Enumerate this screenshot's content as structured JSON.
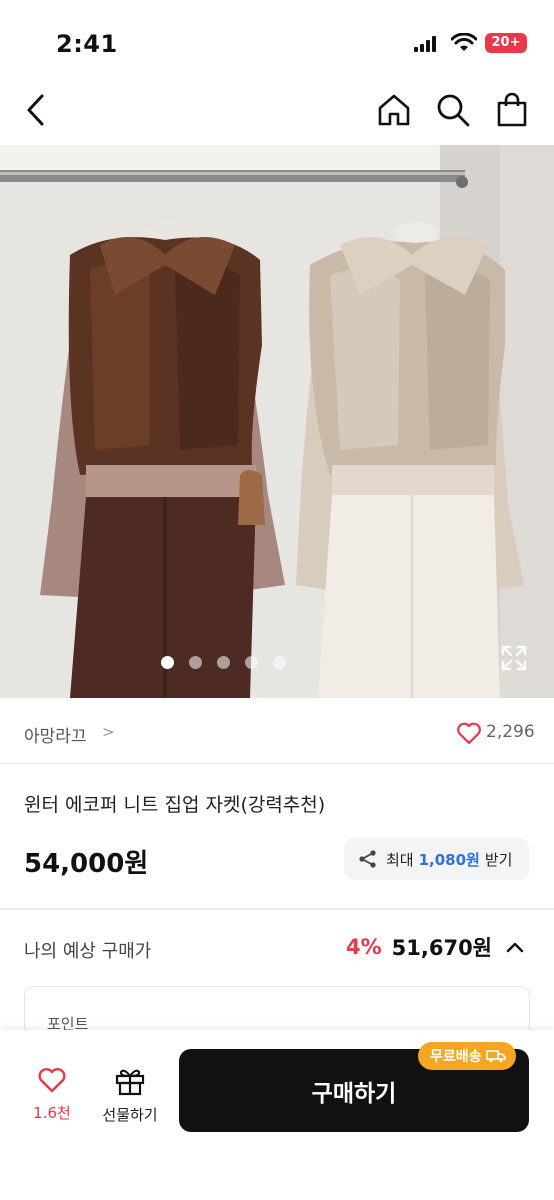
{
  "status": {
    "time": "2:41",
    "battery": "20+"
  },
  "nav": {
    "back": "back-arrow-icon",
    "home": "home-icon",
    "search": "search-icon",
    "bag": "shopping-bag-icon"
  },
  "product": {
    "brand": "아망라끄",
    "brand_chevron": ">",
    "likes": "2,296",
    "name": "윈터 에코퍼 니트 집업 자켓(강력추천)",
    "price": "54,000원",
    "coupon": {
      "prefix": "최대",
      "amount": "1,080원",
      "suffix": "받기"
    },
    "expected": {
      "label": "나의 예상 구매가",
      "discount": "4%",
      "price": "51,670원"
    },
    "point_label": "포인트"
  },
  "gallery": {
    "current": 1,
    "total": 5
  },
  "bottom": {
    "wish_count": "1.6천",
    "gift_label": "선물하기",
    "buy_label": "구매하기",
    "shipping_badge": "무료배송"
  },
  "colors": {
    "accent": "#e8384a",
    "link_blue": "#2f6fe0",
    "badge": "#f5a623"
  }
}
